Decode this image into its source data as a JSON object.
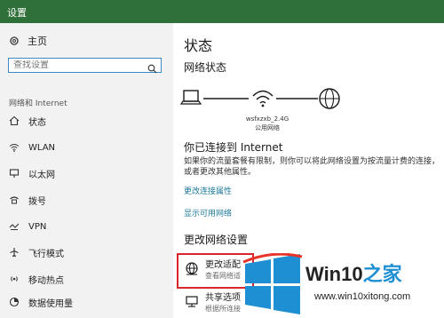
{
  "window": {
    "title": "设置"
  },
  "sidebar": {
    "home": "主页",
    "search_placeholder": "查找设置",
    "section": "网络和 Internet",
    "items": [
      {
        "label": "状态",
        "icon": "home-outline-icon"
      },
      {
        "label": "WLAN",
        "icon": "wifi-icon"
      },
      {
        "label": "以太网",
        "icon": "ethernet-icon"
      },
      {
        "label": "拨号",
        "icon": "dialup-icon"
      },
      {
        "label": "VPN",
        "icon": "vpn-icon"
      },
      {
        "label": "飞行模式",
        "icon": "airplane-icon"
      },
      {
        "label": "移动热点",
        "icon": "hotspot-icon"
      },
      {
        "label": "数据使用量",
        "icon": "data-usage-icon"
      }
    ]
  },
  "main": {
    "title": "状态",
    "network_status": "网络状态",
    "ssid": "wsfxzxb_2.4G",
    "profile": "公用网络",
    "connected_heading": "你已连接到 Internet",
    "connected_desc": "如果你的流量套餐有限制，则你可以将此网络设置为按流量计费的连接，或者更改其他属性。",
    "link_change_props": "更改连接属性",
    "link_show_networks": "显示可用网络",
    "change_heading": "更改网络设置",
    "options": [
      {
        "title": "更改适配",
        "subtitle": "查看网络适"
      },
      {
        "title": "共享选项",
        "subtitle": "根据所连接"
      }
    ]
  },
  "watermark": {
    "brand_prefix": "Win10",
    "brand_suffix": "之家",
    "url": "www.win10xitong.com",
    "colors": [
      "#e8352b",
      "#1e8fd2"
    ]
  },
  "colors": {
    "titlebar": "#2f6f3a",
    "accent_link": "#1c7a9b",
    "highlight_box": "#d9262c"
  }
}
